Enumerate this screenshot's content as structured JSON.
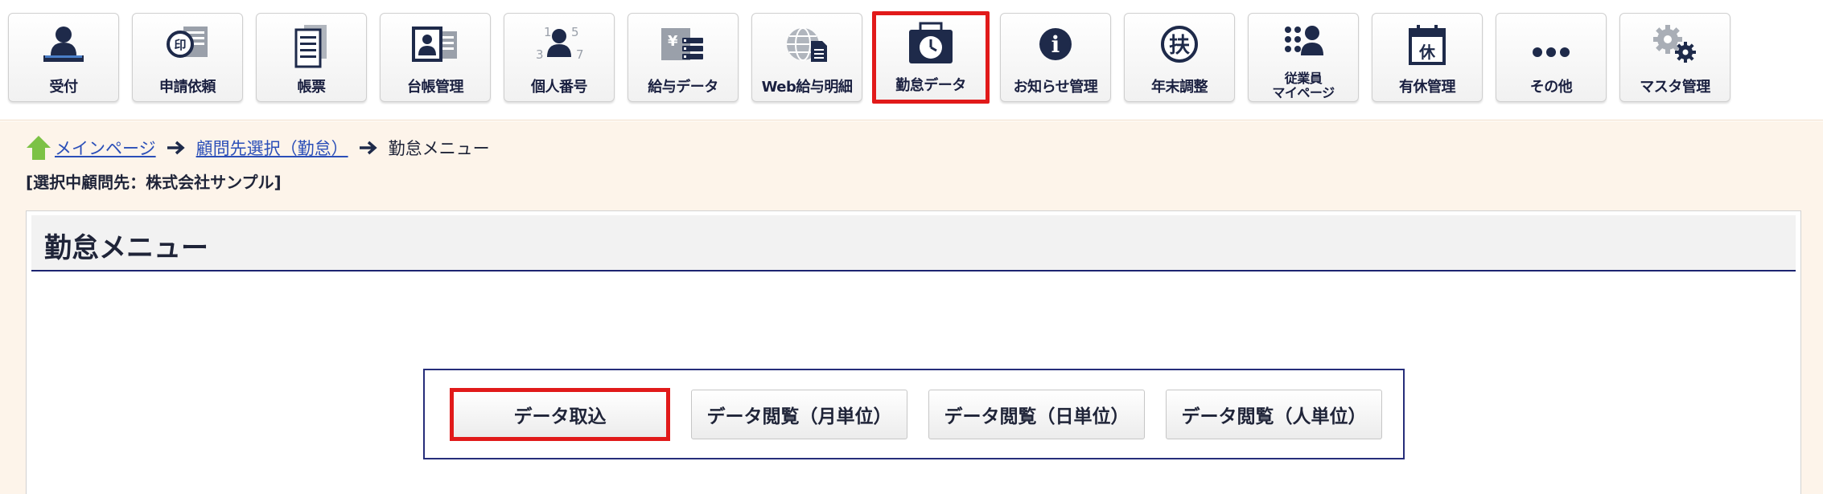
{
  "toolbar": {
    "items": [
      {
        "label": "受付",
        "icon": "reception-person-icon"
      },
      {
        "label": "申請依頼",
        "icon": "stamp-document-icon"
      },
      {
        "label": "帳票",
        "icon": "ledger-document-icon"
      },
      {
        "label": "台帳管理",
        "icon": "id-card-icon"
      },
      {
        "label": "個人番号",
        "icon": "person-number-icon",
        "digits": [
          "1",
          "5",
          "3",
          "7"
        ]
      },
      {
        "label": "給与データ",
        "icon": "payroll-yen-icon",
        "glyph": "¥"
      },
      {
        "label": "Web給与明細",
        "icon": "globe-document-icon"
      },
      {
        "label": "勤怠データ",
        "icon": "attendance-clock-icon",
        "active": true
      },
      {
        "label": "お知らせ管理",
        "icon": "info-icon",
        "glyph": "i"
      },
      {
        "label": "年末調整",
        "icon": "year-end-fu-icon",
        "glyph": "扶"
      },
      {
        "label_line1": "従業員",
        "label_line2": "マイページ",
        "icon": "employee-mypage-icon"
      },
      {
        "label": "有休管理",
        "icon": "paid-leave-calendar-icon",
        "glyph": "休"
      },
      {
        "label": "その他",
        "icon": "more-dots-icon"
      },
      {
        "label": "マスタ管理",
        "icon": "gears-icon"
      }
    ]
  },
  "breadcrumb": {
    "home": "メインページ",
    "client_select": "顧問先選択（勤怠）",
    "current": "勤怠メニュー"
  },
  "selected_client": "[選択中顧問先：株式会社サンプル]",
  "panel": {
    "title": "勤怠メニュー",
    "buttons": [
      {
        "label": "データ取込",
        "active": true
      },
      {
        "label": "データ閲覧（月単位）"
      },
      {
        "label": "データ閲覧（日単位）"
      },
      {
        "label": "データ閲覧（人単位）"
      }
    ]
  },
  "colors": {
    "accent_red": "#e11a1a",
    "navy": "#1c2470",
    "content_bg": "#fdf4ea",
    "link": "#2b4fb8",
    "home_green": "#7cc245"
  }
}
